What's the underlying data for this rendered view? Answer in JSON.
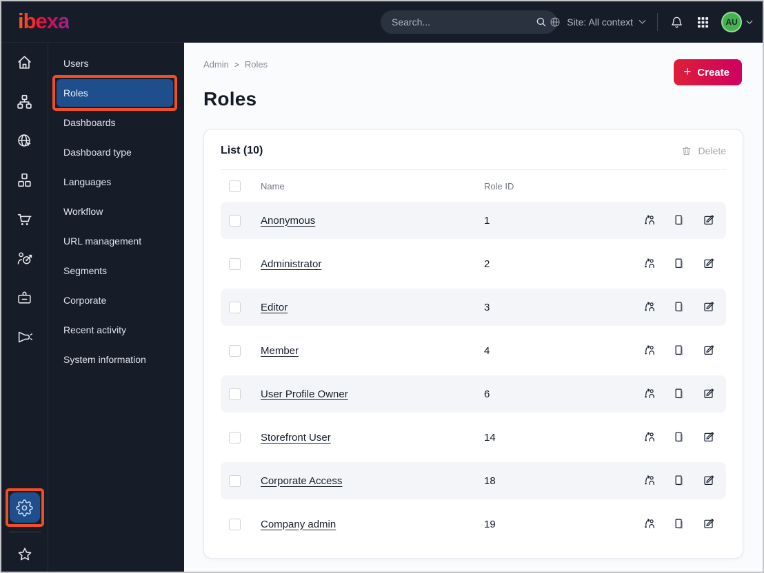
{
  "topbar": {
    "logo": "ibexa",
    "search": {
      "placeholder": "Search..."
    },
    "site_context": "Site: All context",
    "avatar_initials": "AU",
    "icons": [
      "globe-icon",
      "chevron-down-icon",
      "bell-icon",
      "app-grid-icon",
      "avatar-chevron-icon",
      "search-icon"
    ]
  },
  "icon_rail": {
    "items": [
      "home",
      "content-structure",
      "site",
      "products",
      "commerce",
      "segments",
      "corporate",
      "marketing"
    ],
    "bottom_items": [
      "settings",
      "bookmarks"
    ]
  },
  "submenu": {
    "items": [
      {
        "label": "Users",
        "active": false
      },
      {
        "label": "Roles",
        "active": true
      },
      {
        "label": "Dashboards",
        "active": false
      },
      {
        "label": "Dashboard type",
        "active": false
      },
      {
        "label": "Languages",
        "active": false
      },
      {
        "label": "Workflow",
        "active": false
      },
      {
        "label": "URL management",
        "active": false
      },
      {
        "label": "Segments",
        "active": false
      },
      {
        "label": "Corporate",
        "active": false
      },
      {
        "label": "Recent activity",
        "active": false
      },
      {
        "label": "System information",
        "active": false
      }
    ]
  },
  "breadcrumb": {
    "items": [
      "Admin",
      "Roles"
    ]
  },
  "page": {
    "title": "Roles"
  },
  "create_button": {
    "label": "Create",
    "plus": "+"
  },
  "list_card": {
    "title": "List (10)",
    "delete_label": "Delete",
    "columns": [
      "Name",
      "Role ID"
    ],
    "row_actions": [
      "assign",
      "copy",
      "edit"
    ],
    "rows": [
      {
        "name": "Anonymous",
        "role_id": "1"
      },
      {
        "name": "Administrator",
        "role_id": "2"
      },
      {
        "name": "Editor",
        "role_id": "3"
      },
      {
        "name": "Member",
        "role_id": "4"
      },
      {
        "name": "User Profile Owner",
        "role_id": "6"
      },
      {
        "name": "Storefront User",
        "role_id": "14"
      },
      {
        "name": "Corporate Access",
        "role_id": "18"
      },
      {
        "name": "Company admin",
        "role_id": "19"
      }
    ]
  },
  "annotations": {
    "highlight_color": "#f04e23",
    "targets": [
      "submenu-item-roles",
      "settings-button"
    ]
  },
  "colors": {
    "navy": "#161d29",
    "selected_blue": "#1f4e8c",
    "accent_orange": "#f04e23",
    "create_gradient_start": "#dd2038",
    "create_gradient_end": "#cf0060",
    "avatar_green": "#46b151",
    "row_stripe": "#f4f5f8"
  }
}
